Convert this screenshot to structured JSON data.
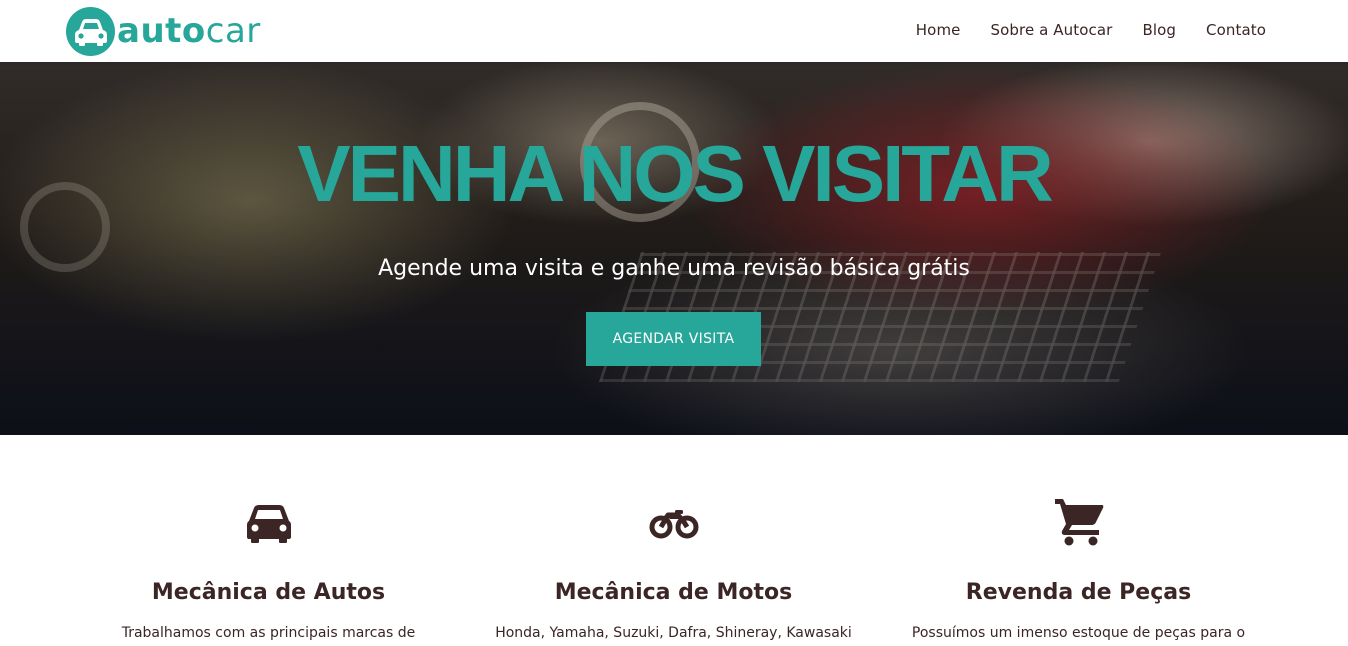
{
  "brand": {
    "logo_bold": "auto",
    "logo_light": "car",
    "color": "#27a69a"
  },
  "nav": {
    "items": [
      {
        "label": "Home"
      },
      {
        "label": "Sobre a Autocar"
      },
      {
        "label": "Blog"
      },
      {
        "label": "Contato"
      }
    ]
  },
  "hero": {
    "title": "VENHA NOS VISITAR",
    "subtitle": "Agende uma visita e ganhe uma revisão básica grátis",
    "button_label": "AGENDAR VISITA"
  },
  "services": [
    {
      "icon": "car-icon",
      "title": "Mecânica de Autos",
      "text": "Trabalhamos com as principais marcas de"
    },
    {
      "icon": "motorcycle-icon",
      "title": "Mecânica de Motos",
      "text": "Honda, Yamaha, Suzuki, Dafra, Shineray, Kawasaki"
    },
    {
      "icon": "shopping-cart-icon",
      "title": "Revenda de Peças",
      "text": "Possuímos um imenso estoque de peças para o"
    }
  ],
  "colors": {
    "accent": "#27a69a",
    "text_dark": "#3b2525",
    "white": "#ffffff"
  }
}
